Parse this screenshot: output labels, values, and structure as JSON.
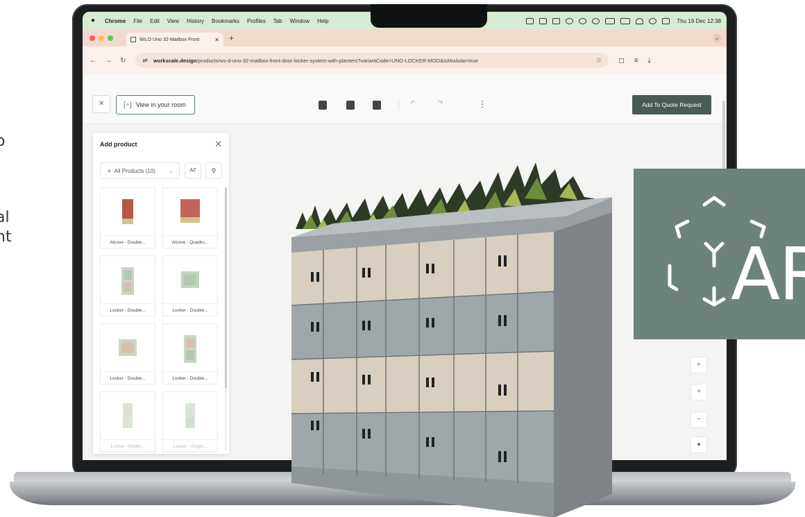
{
  "menubar": {
    "items": [
      "Chrome",
      "File",
      "Edit",
      "View",
      "History",
      "Bookmarks",
      "Profiles",
      "Tab",
      "Window",
      "Help"
    ],
    "clock": "Thu 19 Dec 12:38",
    "status_icons": [
      "dropbox-icon",
      "screen-mirror-icon",
      "dice-icon",
      "cloud-icon",
      "record-icon",
      "moon-icon",
      "hr-badge-icon",
      "battery-icon",
      "wifi-icon",
      "spotlight-icon",
      "control-center-icon"
    ]
  },
  "browser": {
    "tab_title": "Ws.D Uno 32-Mailbox Front",
    "url_host": "workscale.design",
    "url_path": "/products/ws-d-uno-32-mailbox-front-door-locker-system-with-planters?variantCode=UNO-LOCKER-MOD&isModular=true",
    "traffic_colors": [
      "#ec5f56",
      "#f3be4f",
      "#5bc75a"
    ]
  },
  "app": {
    "view_room_label": "View in your room",
    "add_quote_label": "Add To Quote Request",
    "accent": "#4a5a55",
    "room_button_border": "#4f7c6e"
  },
  "panel": {
    "title": "Add product",
    "filter_label": "All Products (10)",
    "sort_label": "AZ",
    "products": [
      {
        "label": "Alcove - Double...",
        "thumb": "alcove-double"
      },
      {
        "label": "Alcove - Quadru...",
        "thumb": "alcove-quad"
      },
      {
        "label": "Locker - Double...",
        "thumb": "locker-tall"
      },
      {
        "label": "Locker - Double...",
        "thumb": "locker-square"
      },
      {
        "label": "Locker - Double...",
        "thumb": "locker-square"
      },
      {
        "label": "Locker - Double...",
        "thumb": "locker-tall"
      },
      {
        "label": "Locker - Single...",
        "thumb": "locker-slim"
      },
      {
        "label": "Locker - Single...",
        "thumb": "locker-slim"
      }
    ]
  },
  "side_text": {
    "line1": "o",
    "line2": "al",
    "line3": "nt"
  },
  "ar_badge": {
    "text": "AR",
    "background": "#6e827c"
  }
}
